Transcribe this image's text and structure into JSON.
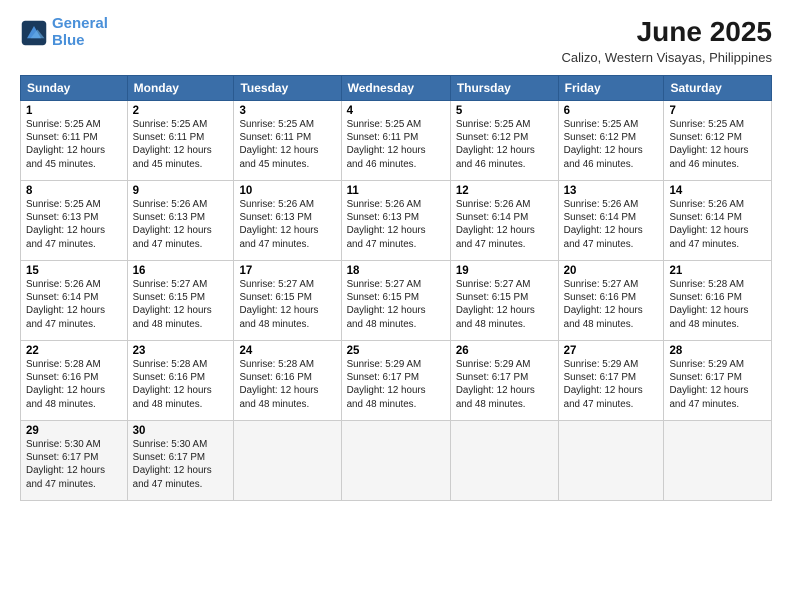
{
  "logo": {
    "line1": "General",
    "line2": "Blue"
  },
  "title": "June 2025",
  "subtitle": "Calizo, Western Visayas, Philippines",
  "days_of_week": [
    "Sunday",
    "Monday",
    "Tuesday",
    "Wednesday",
    "Thursday",
    "Friday",
    "Saturday"
  ],
  "weeks": [
    [
      {
        "day": "1",
        "sunrise": "5:25 AM",
        "sunset": "6:11 PM",
        "daylight": "12 hours and 45 minutes."
      },
      {
        "day": "2",
        "sunrise": "5:25 AM",
        "sunset": "6:11 PM",
        "daylight": "12 hours and 45 minutes."
      },
      {
        "day": "3",
        "sunrise": "5:25 AM",
        "sunset": "6:11 PM",
        "daylight": "12 hours and 45 minutes."
      },
      {
        "day": "4",
        "sunrise": "5:25 AM",
        "sunset": "6:11 PM",
        "daylight": "12 hours and 46 minutes."
      },
      {
        "day": "5",
        "sunrise": "5:25 AM",
        "sunset": "6:12 PM",
        "daylight": "12 hours and 46 minutes."
      },
      {
        "day": "6",
        "sunrise": "5:25 AM",
        "sunset": "6:12 PM",
        "daylight": "12 hours and 46 minutes."
      },
      {
        "day": "7",
        "sunrise": "5:25 AM",
        "sunset": "6:12 PM",
        "daylight": "12 hours and 46 minutes."
      }
    ],
    [
      {
        "day": "8",
        "sunrise": "5:25 AM",
        "sunset": "6:13 PM",
        "daylight": "12 hours and 47 minutes."
      },
      {
        "day": "9",
        "sunrise": "5:26 AM",
        "sunset": "6:13 PM",
        "daylight": "12 hours and 47 minutes."
      },
      {
        "day": "10",
        "sunrise": "5:26 AM",
        "sunset": "6:13 PM",
        "daylight": "12 hours and 47 minutes."
      },
      {
        "day": "11",
        "sunrise": "5:26 AM",
        "sunset": "6:13 PM",
        "daylight": "12 hours and 47 minutes."
      },
      {
        "day": "12",
        "sunrise": "5:26 AM",
        "sunset": "6:14 PM",
        "daylight": "12 hours and 47 minutes."
      },
      {
        "day": "13",
        "sunrise": "5:26 AM",
        "sunset": "6:14 PM",
        "daylight": "12 hours and 47 minutes."
      },
      {
        "day": "14",
        "sunrise": "5:26 AM",
        "sunset": "6:14 PM",
        "daylight": "12 hours and 47 minutes."
      }
    ],
    [
      {
        "day": "15",
        "sunrise": "5:26 AM",
        "sunset": "6:14 PM",
        "daylight": "12 hours and 47 minutes."
      },
      {
        "day": "16",
        "sunrise": "5:27 AM",
        "sunset": "6:15 PM",
        "daylight": "12 hours and 48 minutes."
      },
      {
        "day": "17",
        "sunrise": "5:27 AM",
        "sunset": "6:15 PM",
        "daylight": "12 hours and 48 minutes."
      },
      {
        "day": "18",
        "sunrise": "5:27 AM",
        "sunset": "6:15 PM",
        "daylight": "12 hours and 48 minutes."
      },
      {
        "day": "19",
        "sunrise": "5:27 AM",
        "sunset": "6:15 PM",
        "daylight": "12 hours and 48 minutes."
      },
      {
        "day": "20",
        "sunrise": "5:27 AM",
        "sunset": "6:16 PM",
        "daylight": "12 hours and 48 minutes."
      },
      {
        "day": "21",
        "sunrise": "5:28 AM",
        "sunset": "6:16 PM",
        "daylight": "12 hours and 48 minutes."
      }
    ],
    [
      {
        "day": "22",
        "sunrise": "5:28 AM",
        "sunset": "6:16 PM",
        "daylight": "12 hours and 48 minutes."
      },
      {
        "day": "23",
        "sunrise": "5:28 AM",
        "sunset": "6:16 PM",
        "daylight": "12 hours and 48 minutes."
      },
      {
        "day": "24",
        "sunrise": "5:28 AM",
        "sunset": "6:16 PM",
        "daylight": "12 hours and 48 minutes."
      },
      {
        "day": "25",
        "sunrise": "5:29 AM",
        "sunset": "6:17 PM",
        "daylight": "12 hours and 48 minutes."
      },
      {
        "day": "26",
        "sunrise": "5:29 AM",
        "sunset": "6:17 PM",
        "daylight": "12 hours and 48 minutes."
      },
      {
        "day": "27",
        "sunrise": "5:29 AM",
        "sunset": "6:17 PM",
        "daylight": "12 hours and 47 minutes."
      },
      {
        "day": "28",
        "sunrise": "5:29 AM",
        "sunset": "6:17 PM",
        "daylight": "12 hours and 47 minutes."
      }
    ],
    [
      {
        "day": "29",
        "sunrise": "5:30 AM",
        "sunset": "6:17 PM",
        "daylight": "12 hours and 47 minutes."
      },
      {
        "day": "30",
        "sunrise": "5:30 AM",
        "sunset": "6:17 PM",
        "daylight": "12 hours and 47 minutes."
      },
      null,
      null,
      null,
      null,
      null
    ]
  ]
}
